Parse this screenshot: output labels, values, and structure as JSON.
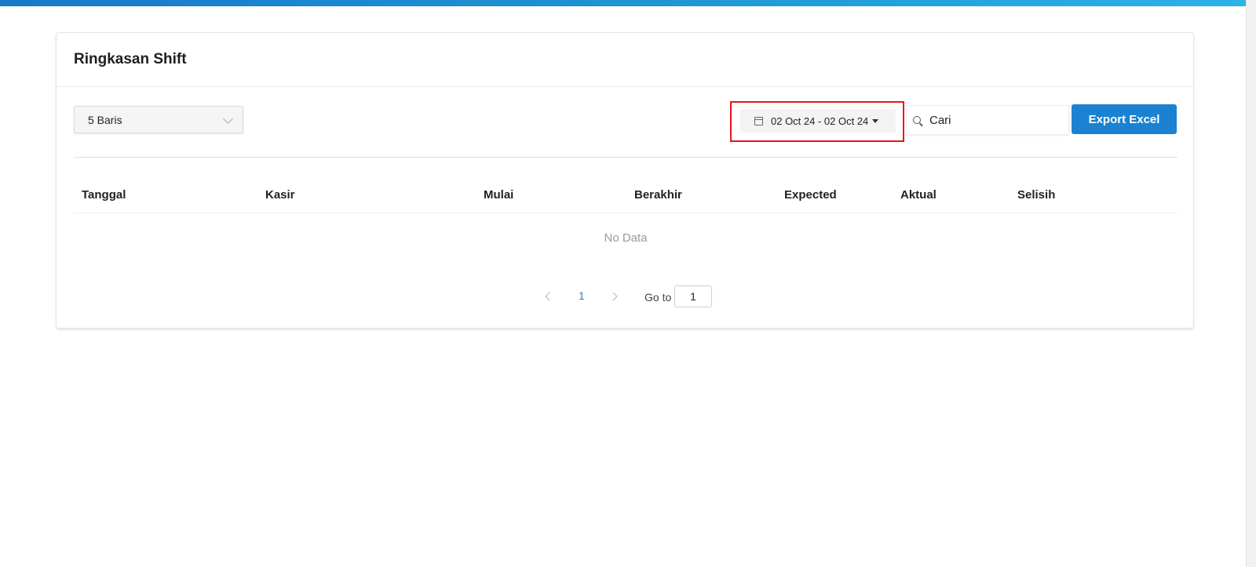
{
  "page": {
    "title": "Ringkasan Shift"
  },
  "toolbar": {
    "rows_select": "5 Baris",
    "date_range": "02 Oct 24 - 02 Oct 24",
    "search_placeholder": "Cari",
    "export_label": "Export Excel"
  },
  "table": {
    "columns": [
      "Tanggal",
      "Kasir",
      "Mulai",
      "Berakhir",
      "Expected",
      "Aktual",
      "Selisih"
    ],
    "rows": [],
    "empty_text": "No Data"
  },
  "pagination": {
    "current_page": "1",
    "goto_label": "Go to",
    "goto_value": "1"
  },
  "colors": {
    "accent": "#1a82d0",
    "highlight": "#e8141c",
    "topbar": "#1f9ad8"
  }
}
